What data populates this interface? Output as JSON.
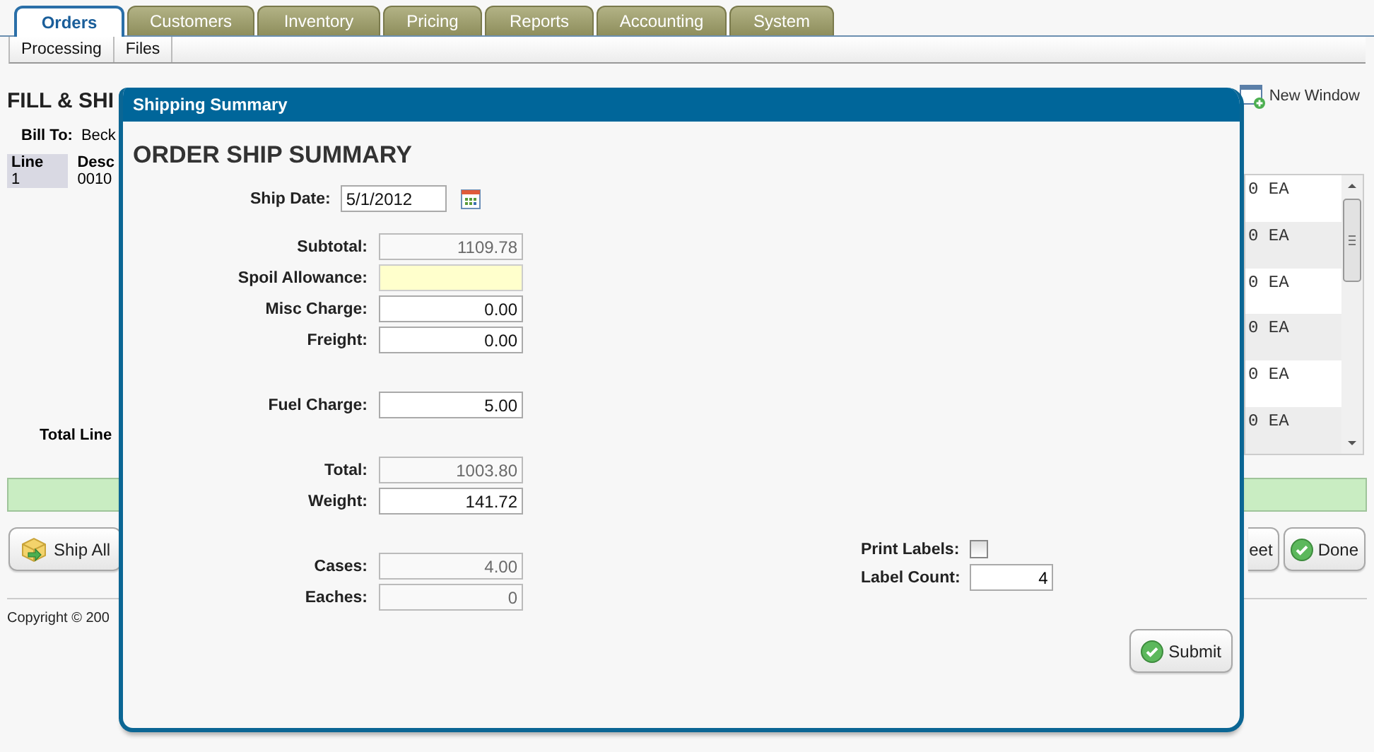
{
  "main_tabs": [
    {
      "label": "Orders",
      "selected": true
    },
    {
      "label": "Customers",
      "selected": false
    },
    {
      "label": "Inventory",
      "selected": false
    },
    {
      "label": "Pricing",
      "selected": false
    },
    {
      "label": "Reports",
      "selected": false
    },
    {
      "label": "Accounting",
      "selected": false
    },
    {
      "label": "System",
      "selected": false
    }
  ],
  "sub_tabs": [
    {
      "label": "Processing"
    },
    {
      "label": "Files"
    }
  ],
  "page": {
    "title": "FILL & SHI",
    "new_window": "New Window",
    "bill_to_label": "Bill To:",
    "bill_to_value": "Beck",
    "table": {
      "columns": [
        "Line",
        "Desc"
      ],
      "rows": [
        [
          "1",
          "0010"
        ]
      ]
    },
    "uom_cells": [
      "0 EA",
      "0 EA",
      "0 EA",
      "0 EA",
      "0 EA",
      "0 EA"
    ],
    "total_label": "Total Line",
    "buttons_left": [
      "Ship All"
    ],
    "buttons_right": [
      {
        "label": "eet",
        "kind": "plain"
      },
      {
        "label": "Done",
        "kind": "check"
      }
    ],
    "copyright": "Copyright © 200"
  },
  "dialog": {
    "title": "Shipping Summary",
    "heading": "ORDER SHIP SUMMARY",
    "ship_date": {
      "label": "Ship Date:",
      "value": "5/1/2012"
    },
    "groups": [
      [
        {
          "label": "Subtotal:",
          "value": "1109.78",
          "kind": "readonly"
        },
        {
          "label": "Spoil Allowance:",
          "kind": "highlighted"
        },
        {
          "label": "Misc Charge:",
          "value": "0.00",
          "kind": "editable"
        },
        {
          "label": "Freight:",
          "value": "0.00",
          "kind": "editable"
        }
      ],
      [
        {
          "label": "Fuel Charge:",
          "value": "5.00",
          "kind": "editable"
        }
      ],
      [
        {
          "label": "Total:",
          "value": "1003.80",
          "kind": "readonly"
        },
        {
          "label": "Weight:",
          "value": "141.72",
          "kind": "editable"
        }
      ],
      [
        {
          "label": "Cases:",
          "value": "4.00",
          "kind": "readonly"
        },
        {
          "label": "Eaches:",
          "value": "0",
          "kind": "readonly"
        }
      ]
    ],
    "print_labels": {
      "label": "Print Labels:",
      "checked": false
    },
    "label_count": {
      "label": "Label Count:",
      "value": "4"
    },
    "submit": "Submit"
  }
}
